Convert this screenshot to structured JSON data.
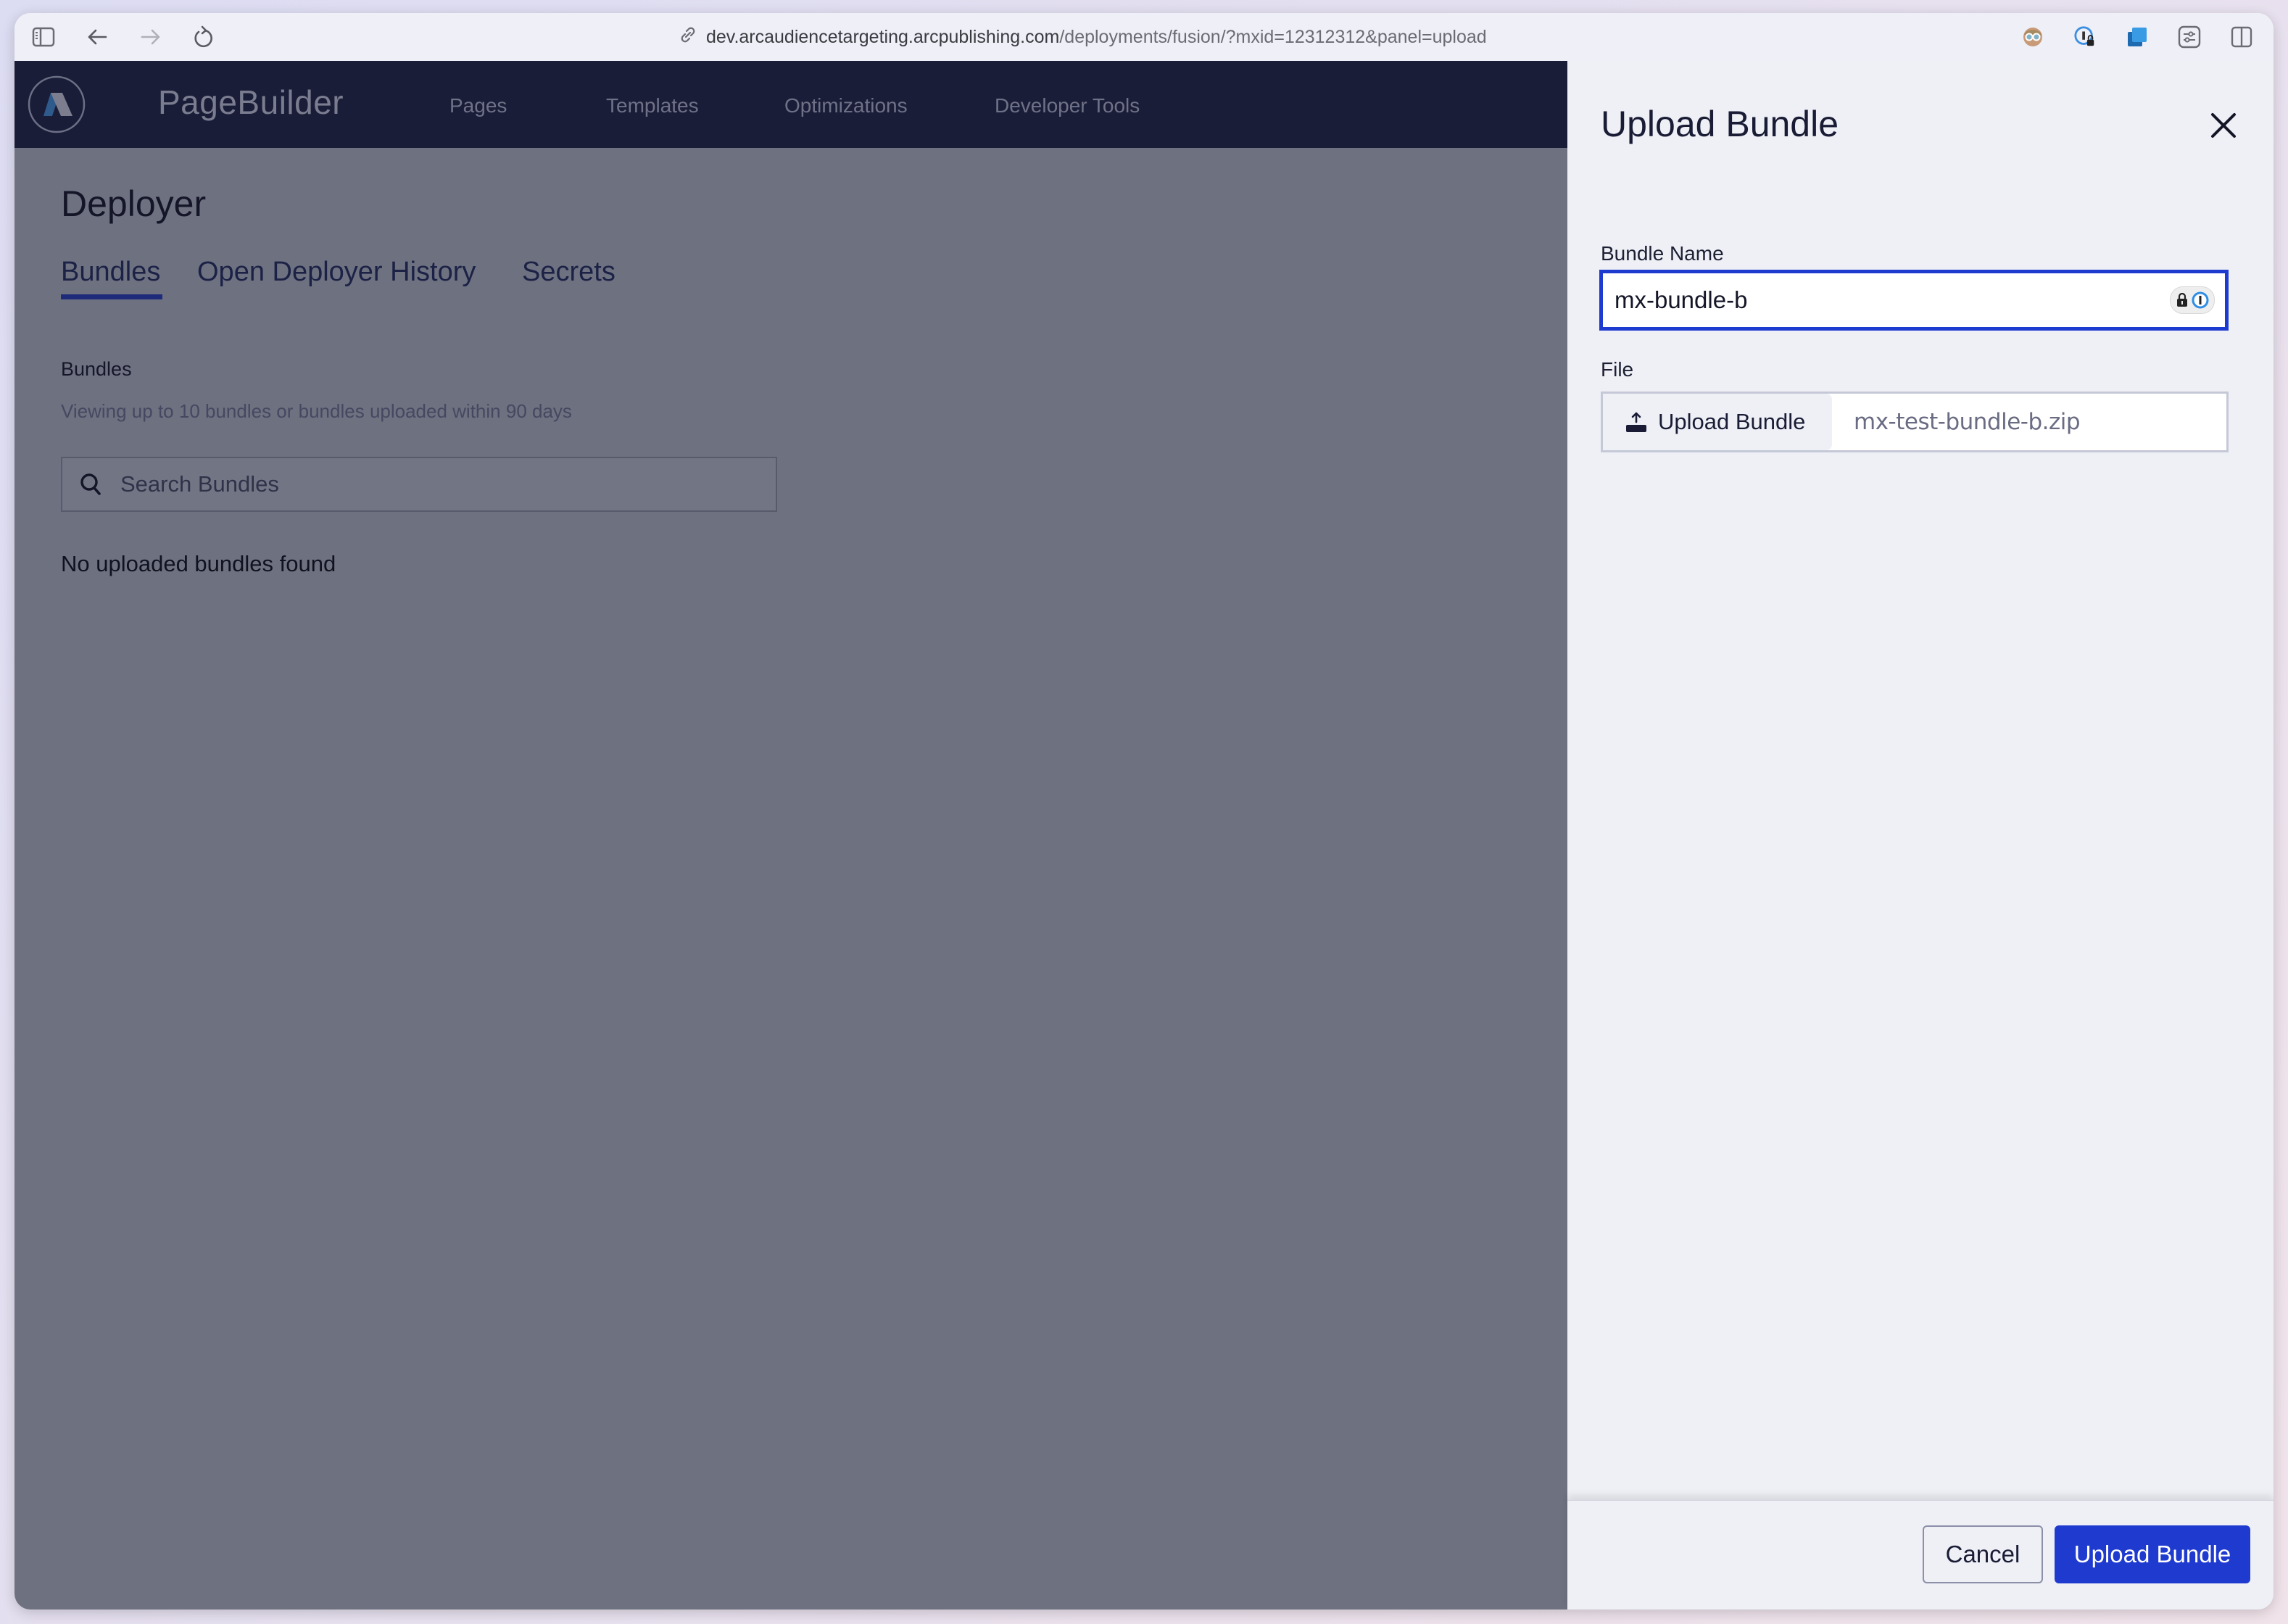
{
  "browser": {
    "url_host": "dev.arcaudiencetargeting.arcpublishing.com",
    "url_path": "/deployments/fusion/?mxid=12312312&panel=upload",
    "left_icons": [
      "sidebar-toggle-icon",
      "back-arrow-icon",
      "forward-arrow-icon",
      "reload-icon"
    ],
    "right_icons": [
      "profile-avatar-icon",
      "password-manager-icon",
      "extension-icon",
      "settings-sliders-icon",
      "split-view-icon"
    ]
  },
  "nav": {
    "brand": "PageBuilder",
    "items": [
      "Pages",
      "Templates",
      "Optimizations",
      "Developer Tools"
    ]
  },
  "page": {
    "title": "Deployer",
    "tabs": [
      {
        "label": "Bundles",
        "active": true
      },
      {
        "label": "Open Deployer History",
        "active": false
      },
      {
        "label": "Secrets",
        "active": false
      }
    ],
    "section_label": "Bundles",
    "section_subtitle": "Viewing up to 10 bundles or bundles uploaded within 90 days",
    "search_placeholder": "Search Bundles",
    "empty_message": "No uploaded bundles found"
  },
  "panel": {
    "title": "Upload Bundle",
    "bundle_name_label": "Bundle Name",
    "bundle_name_value": "mx-bundle-b",
    "file_label": "File",
    "file_button_label": "Upload Bundle",
    "file_name": "mx-test-bundle-b.zip",
    "cancel_label": "Cancel",
    "submit_label": "Upload Bundle"
  },
  "colors": {
    "nav_bg": "#1a1d38",
    "overlay": "#6e7180",
    "panel_bg": "#eef0f6",
    "primary": "#1f3bcf",
    "tab_underline": "#1e2a7a"
  }
}
